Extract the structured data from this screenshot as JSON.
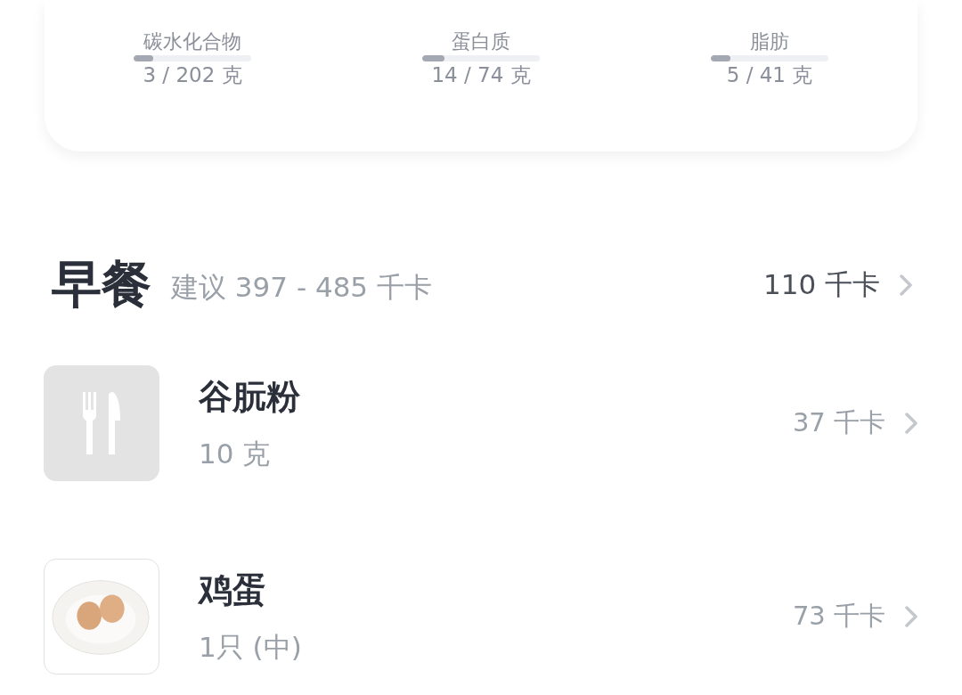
{
  "nutrients": [
    {
      "name": "碳水化合物",
      "level": 0.17,
      "amount": "3 / 202 克"
    },
    {
      "name": "蛋白质",
      "level": 0.19,
      "amount": "14 / 74 克"
    },
    {
      "name": "脂肪",
      "level": 0.17,
      "amount": "5 / 41 克"
    }
  ],
  "meal": {
    "title": "早餐",
    "suggestion": "建议 397 - 485 千卡",
    "total": "110 千卡",
    "foods": [
      {
        "kind": "placeholder",
        "name": "谷朊粉",
        "portion": "10 克",
        "calories": "37 千卡"
      },
      {
        "kind": "photo",
        "name": "鸡蛋",
        "portion": "1只 (中)",
        "calories": "73 千卡"
      }
    ]
  }
}
